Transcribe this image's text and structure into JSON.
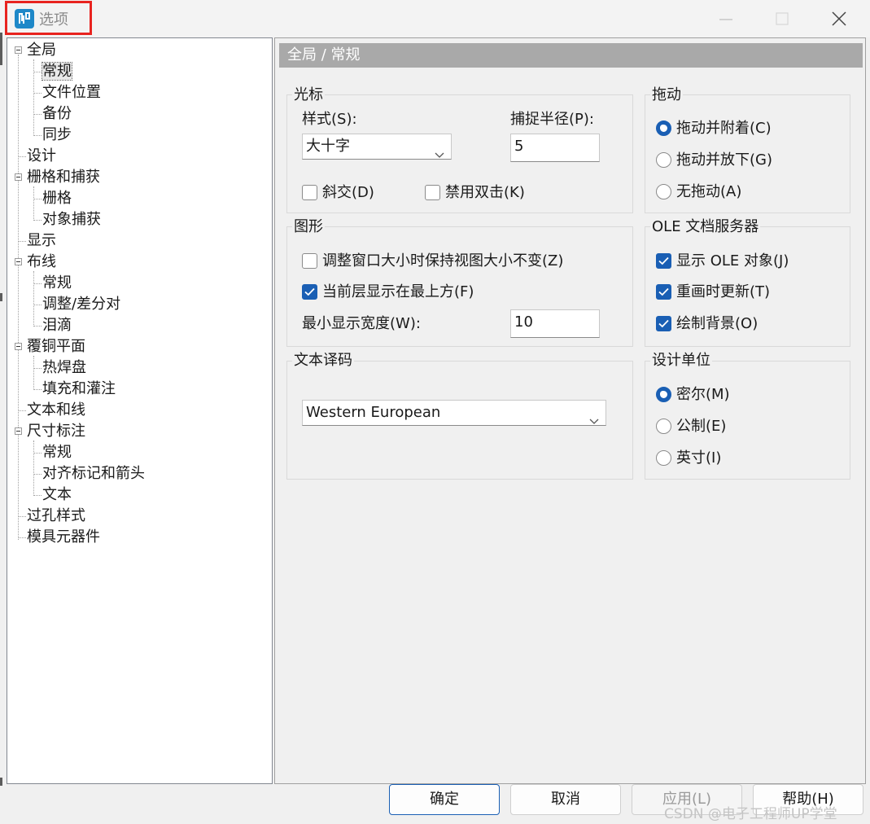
{
  "window": {
    "title": "选项",
    "accent": "#1a5fb4",
    "highlight_color": "#e8231f"
  },
  "tree": {
    "items": [
      {
        "label": "全局",
        "level": 0,
        "expandable": true
      },
      {
        "label": "常规",
        "level": 1,
        "selected": true
      },
      {
        "label": "文件位置",
        "level": 1
      },
      {
        "label": "备份",
        "level": 1
      },
      {
        "label": "同步",
        "level": 1
      },
      {
        "label": "设计",
        "level": 0
      },
      {
        "label": "栅格和捕获",
        "level": 0,
        "expandable": true
      },
      {
        "label": "栅格",
        "level": 1
      },
      {
        "label": "对象捕获",
        "level": 1
      },
      {
        "label": "显示",
        "level": 0
      },
      {
        "label": "布线",
        "level": 0,
        "expandable": true
      },
      {
        "label": "常规",
        "level": 1
      },
      {
        "label": "调整/差分对",
        "level": 1
      },
      {
        "label": "泪滴",
        "level": 1
      },
      {
        "label": "覆铜平面",
        "level": 0,
        "expandable": true
      },
      {
        "label": "热焊盘",
        "level": 1
      },
      {
        "label": "填充和灌注",
        "level": 1
      },
      {
        "label": "文本和线",
        "level": 0
      },
      {
        "label": "尺寸标注",
        "level": 0,
        "expandable": true
      },
      {
        "label": "常规",
        "level": 1
      },
      {
        "label": "对齐标记和箭头",
        "level": 1
      },
      {
        "label": "文本",
        "level": 1
      },
      {
        "label": "过孔样式",
        "level": 0
      },
      {
        "label": "模具元器件",
        "level": 0
      }
    ]
  },
  "panel": {
    "header": "全局 / 常规",
    "cursor": {
      "title": "光标",
      "style_label": "样式(S):",
      "style_value": "大十字",
      "snap_label": "捕捉半径(P):",
      "snap_value": "5",
      "diagonal_label": "斜交(D)",
      "diagonal_checked": false,
      "disable_dblclick_label": "禁用双击(K)",
      "disable_dblclick_checked": false
    },
    "drag": {
      "title": "拖动",
      "options": [
        {
          "label": "拖动并附着(C)",
          "checked": true
        },
        {
          "label": "拖动并放下(G)",
          "checked": false
        },
        {
          "label": "无拖动(A)",
          "checked": false
        }
      ]
    },
    "graphics": {
      "title": "图形",
      "keep_view_label": "调整窗口大小时保持视图大小不变(Z)",
      "keep_view_checked": false,
      "active_layer_label": "当前层显示在最上方(F)",
      "active_layer_checked": true,
      "min_width_label": "最小显示宽度(W):",
      "min_width_value": "10"
    },
    "ole": {
      "title": "OLE 文档服务器",
      "options": [
        {
          "label": "显示 OLE 对象(J)",
          "checked": true
        },
        {
          "label": "重画时更新(T)",
          "checked": true
        },
        {
          "label": "绘制背景(O)",
          "checked": true
        }
      ]
    },
    "encoding": {
      "title": "文本译码",
      "value": "Western European"
    },
    "units": {
      "title": "设计单位",
      "options": [
        {
          "label": "密尔(M)",
          "checked": true
        },
        {
          "label": "公制(E)",
          "checked": false
        },
        {
          "label": "英寸(I)",
          "checked": false
        }
      ]
    }
  },
  "buttons": {
    "ok": "确定",
    "cancel": "取消",
    "apply": "应用(L)",
    "help": "帮助(H)"
  },
  "watermark": "CSDN @电子工程师UP学堂"
}
